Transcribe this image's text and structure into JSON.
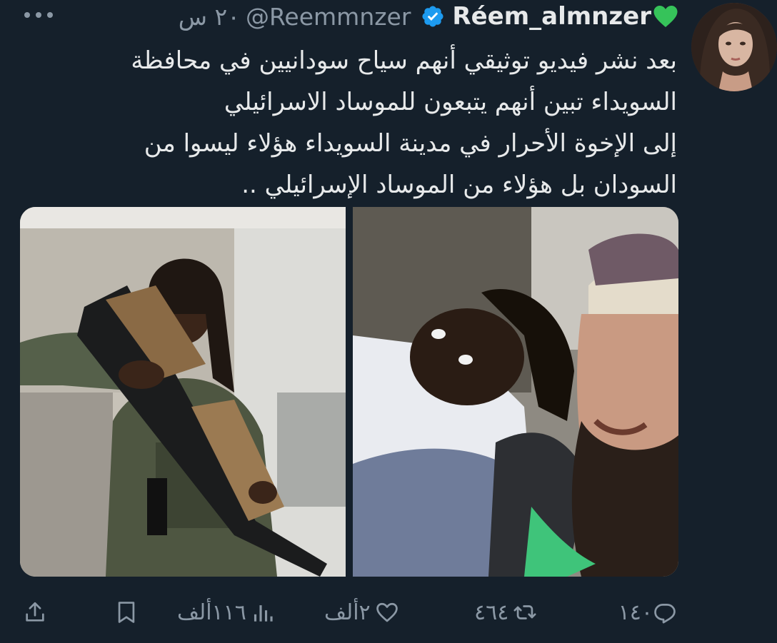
{
  "author": {
    "display_name": "Réem_almnzer",
    "handle": "@Reemmnzer",
    "time": "٢٠ س",
    "verified": true,
    "emoji": "green-heart-icon"
  },
  "tweet": {
    "lines": [
      "بعد نشر فيديو توثيقي أنهم سياح سودانيين في محافظة",
      "السويداء تبين أنهم يتبعون للموساد الاسرائيلي",
      "إلى الإخوة الأحرار في مدينة السويداء هؤلاء ليسوا من",
      "السودان بل هؤلاء من الموساد الإسرائيلي .."
    ]
  },
  "actions": {
    "replies": "١٤٠",
    "retweets": "٤٦٤",
    "likes": "٢ألف",
    "views": "١١٦ألف"
  },
  "colors": {
    "background": "#15202b",
    "text": "#e7e9ea",
    "muted": "#8b98a5",
    "verified": "#1d9bf0",
    "heart": "#36c35a"
  }
}
